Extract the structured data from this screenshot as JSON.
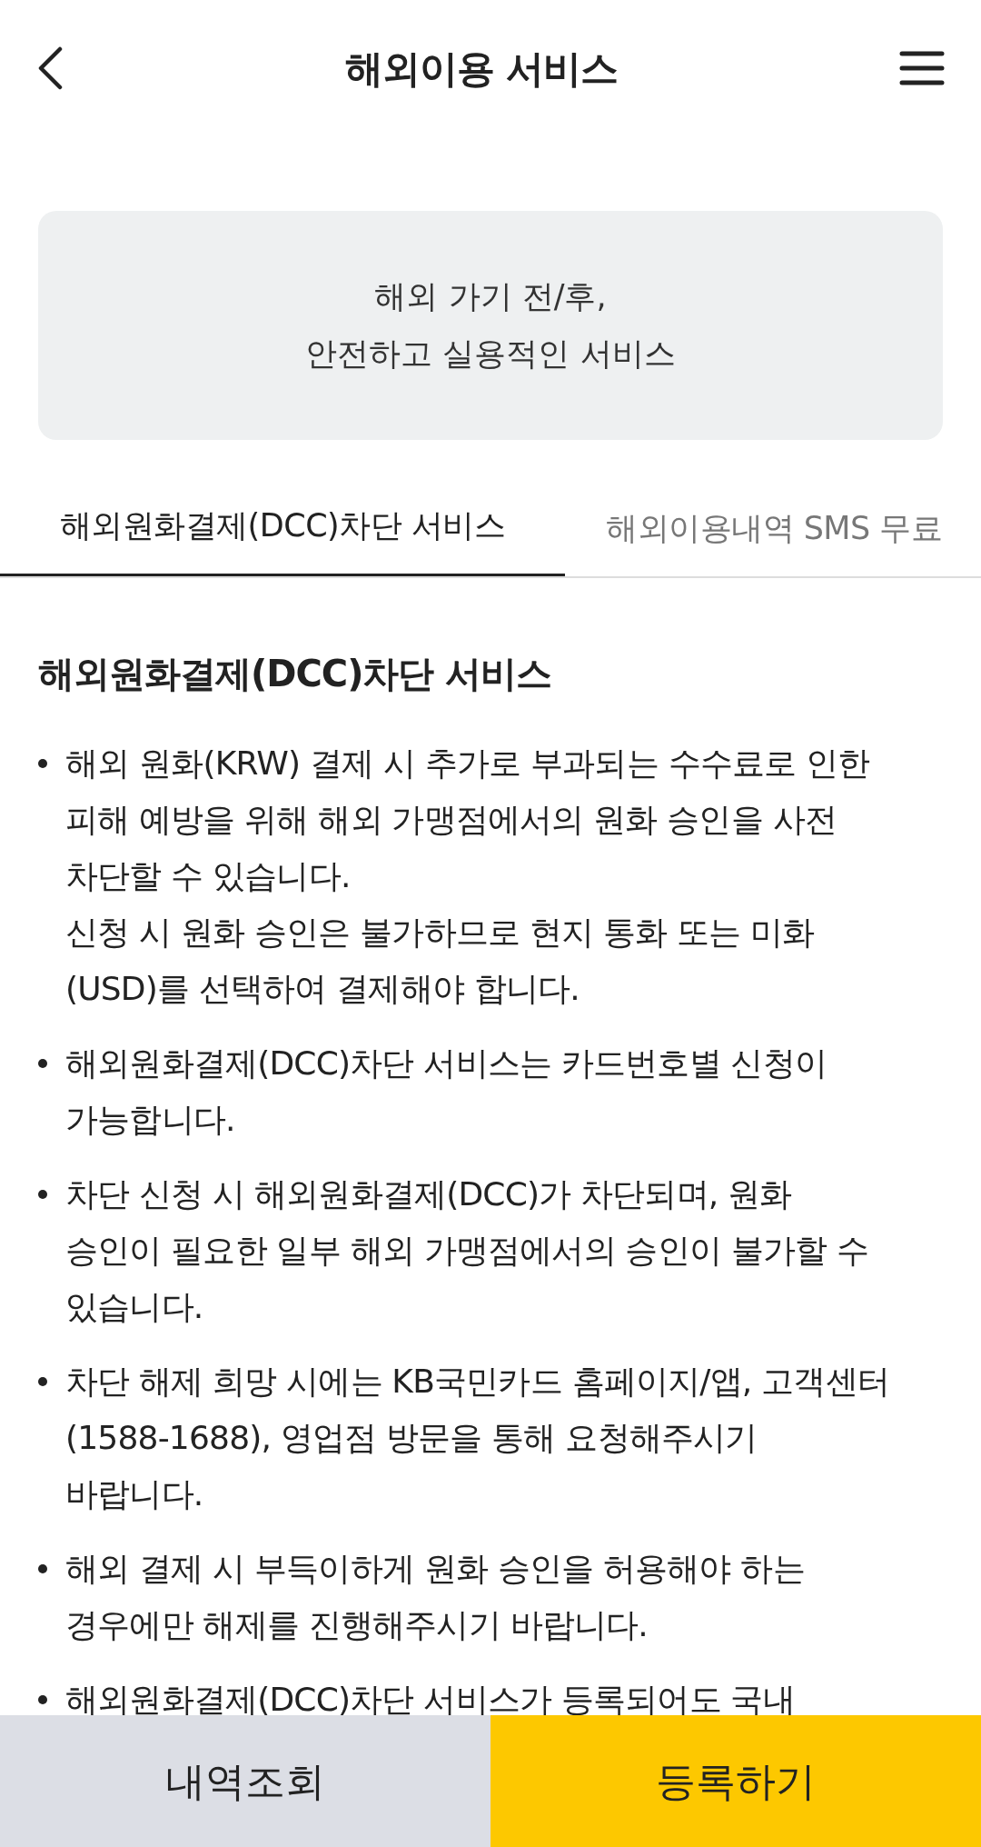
{
  "header": {
    "title": "해외이용 서비스"
  },
  "banner": {
    "text": "해외 가기 전/후,\n안전하고 실용적인 서비스"
  },
  "tabs": [
    {
      "label": "해외원화결제(DCC)차단 서비스",
      "selected": true
    },
    {
      "label": "해외이용내역 SMS 무료",
      "selected": false
    }
  ],
  "section": {
    "title": "해외원화결제(DCC)차단 서비스",
    "items": [
      {
        "text": "해외 원화(KRW) 결제 시 추가로 부과되는 수수료로 인한\n피해 예방을 위해 해외 가맹점에서의 원화 승인을 사전\n차단할 수 있습니다.\n신청 시 원화 승인은 불가하므로 현지 통화 또는 미화\n(USD)를 선택하여 결제해야 합니다."
      },
      {
        "text": "해외원화결제(DCC)차단 서비스는 카드번호별 신청이\n가능합니다."
      },
      {
        "text": "차단 신청 시 해외원화결제(DCC)가 차단되며, 원화\n승인이 필요한 일부 해외 가맹점에서의 승인이 불가할 수\n있습니다."
      },
      {
        "text": "차단 해제 희망 시에는 KB국민카드 홈페이지/앱, 고객센터\n(1588-1688), 영업점 방문을 통해 요청해주시기\n바랍니다."
      },
      {
        "text": "해외 결제 시 부득이하게 원화 승인을 허용해야 하는\n경우에만 해제를 진행해주시기 바랍니다."
      },
      {
        "text": "해외원화결제(DCC)차단 서비스가 등록되어도 국내"
      }
    ]
  },
  "bottom_buttons": [
    {
      "label": "내역조회",
      "kind": "secondary"
    },
    {
      "label": "등록하기",
      "kind": "primary"
    }
  ]
}
